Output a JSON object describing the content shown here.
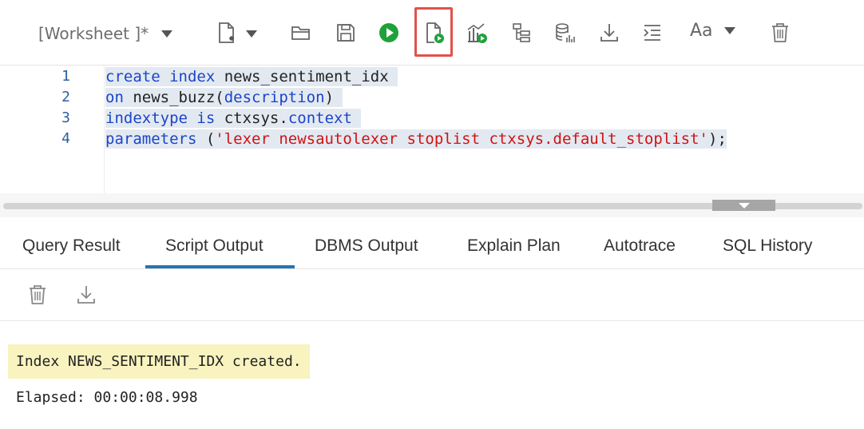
{
  "toolbar": {
    "worksheet_label": "[Worksheet ]*",
    "font_label": "Aa",
    "icons": [
      "new-worksheet-icon",
      "open-icon",
      "save-icon",
      "run-statement-icon",
      "run-script-icon",
      "autotrace-icon",
      "explain-plan-icon",
      "sql-tuning-icon",
      "download-icon",
      "format-icon",
      "font-size-icon",
      "trash-icon"
    ],
    "accent_green": "#1fa23a",
    "highlight_color": "#e2514a"
  },
  "editor": {
    "line_numbers": [
      "1",
      "2",
      "3",
      "4"
    ],
    "lines": [
      [
        {
          "t": "create",
          "c": "kw"
        },
        {
          "t": " "
        },
        {
          "t": "index",
          "c": "kw"
        },
        {
          "t": " news_sentiment_idx "
        }
      ],
      [
        {
          "t": "on",
          "c": "kw"
        },
        {
          "t": " news_buzz("
        },
        {
          "t": "description",
          "c": "kw"
        },
        {
          "t": ") "
        }
      ],
      [
        {
          "t": "indextype",
          "c": "kw"
        },
        {
          "t": " "
        },
        {
          "t": "is",
          "c": "kw"
        },
        {
          "t": " ctxsys."
        },
        {
          "t": "context",
          "c": "kw"
        },
        {
          "t": " "
        }
      ],
      [
        {
          "t": "parameters",
          "c": "kw"
        },
        {
          "t": " ("
        },
        {
          "t": "'lexer newsautolexer stoplist ctxsys.default_stoplist'",
          "c": "str"
        },
        {
          "t": ");"
        }
      ]
    ]
  },
  "tabs": [
    {
      "label": "Query Result",
      "active": false
    },
    {
      "label": "Script Output",
      "active": true
    },
    {
      "label": "DBMS Output",
      "active": false
    },
    {
      "label": "Explain Plan",
      "active": false
    },
    {
      "label": "Autotrace",
      "active": false
    },
    {
      "label": "SQL History",
      "active": false
    }
  ],
  "output": {
    "message": "Index NEWS_SENTIMENT_IDX created.",
    "elapsed": "Elapsed: 00:00:08.998"
  }
}
